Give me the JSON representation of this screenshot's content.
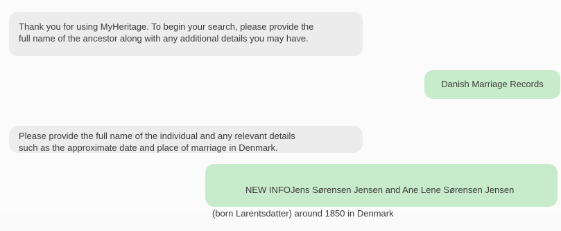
{
  "chat": {
    "messages": [
      {
        "role": "assistant",
        "text": "Thank you for using MyHeritage. To begin your search, please provide the\nfull name of the ancestor along with any additional details you may have."
      },
      {
        "role": "user",
        "text": "Danish Marriage Records"
      },
      {
        "role": "assistant",
        "text": "Please provide the full name of the individual and any relevant details\nsuch as the approximate date and place of marriage in Denmark."
      },
      {
        "role": "user",
        "line1": "NEW INFOJens Sørensen Jensen and Ane Lene Sørensen Jensen",
        "line2": "(born Larentsdatter) around 1850 in Denmark"
      }
    ]
  },
  "colors": {
    "assistant_bubble": "#ececec",
    "user_bubble": "#c8eccb",
    "background": "#fbfbfb",
    "text": "#3a3a3a"
  }
}
